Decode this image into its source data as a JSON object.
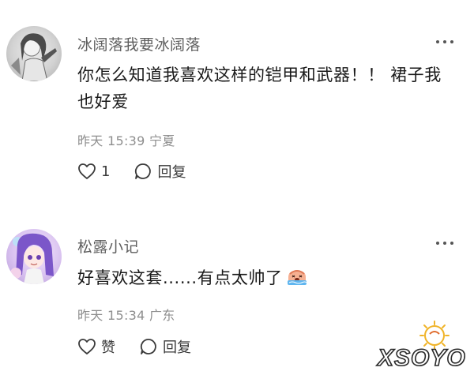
{
  "comments": [
    {
      "user": "冰阔落我要冰阔落",
      "text": "你怎么知道我喜欢这样的铠甲和武器！！ 裙子我也好爱",
      "time": "昨天 15:39",
      "location": "宁夏",
      "like_label": "1",
      "reply_label": "回复",
      "avatar_icon": "avatar-icon"
    },
    {
      "user": "松露小记",
      "text": "好喜欢这套......有点太帅了",
      "time": "昨天 15:34",
      "location": "广东",
      "like_label": "赞",
      "reply_label": "回复",
      "avatar_icon": "avatar-icon",
      "emoji_icon": "crying-emoji-icon"
    }
  ],
  "watermark": {
    "text": "XSOYO"
  },
  "colors": {
    "username": "#5f5f5f",
    "body_text": "#1a1a1a",
    "meta": "#8e8e8e",
    "icon": "#3a3a3a"
  }
}
